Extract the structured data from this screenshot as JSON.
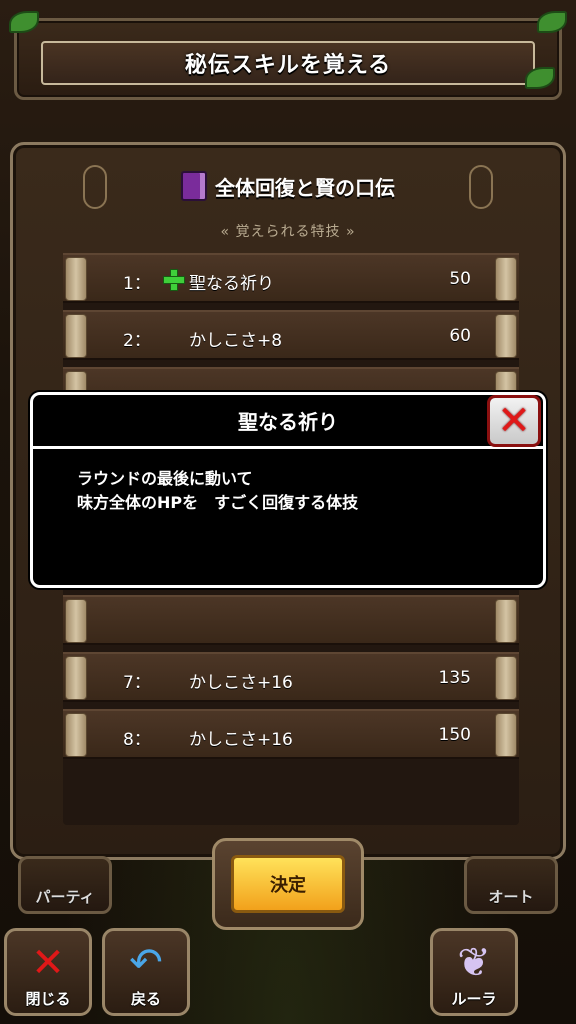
{
  "header": {
    "title": "秘伝スキルを覚える"
  },
  "panel": {
    "title": "全体回復と賢の口伝",
    "subtitle": "覚えられる特技"
  },
  "skills": [
    {
      "num": "1：",
      "name": "聖なる祈り",
      "points": "50",
      "icon": "green-plus-icon"
    },
    {
      "num": "2：",
      "name": "かしこさ+8",
      "points": "60"
    },
    {
      "num": "7：",
      "name": "かしこさ+16",
      "points": "135"
    },
    {
      "num": "8：",
      "name": "かしこさ+16",
      "points": "150"
    }
  ],
  "dialog": {
    "title": "聖なる祈り",
    "line1": "ラウンドの最後に動いて",
    "line2": "味方全体のHPを　すごく回復する体技",
    "close_icon": "red-x-icon"
  },
  "confirm": {
    "label": "決定"
  },
  "bottom": {
    "party": "パーティ",
    "auto": "オート",
    "close": "閉じる",
    "back": "戻る",
    "rura": "ルーラ"
  },
  "colors": {
    "confirm_button": "#f7c52a",
    "close_button_x": "#e01818",
    "heal_plus": "#3fcf3a"
  }
}
